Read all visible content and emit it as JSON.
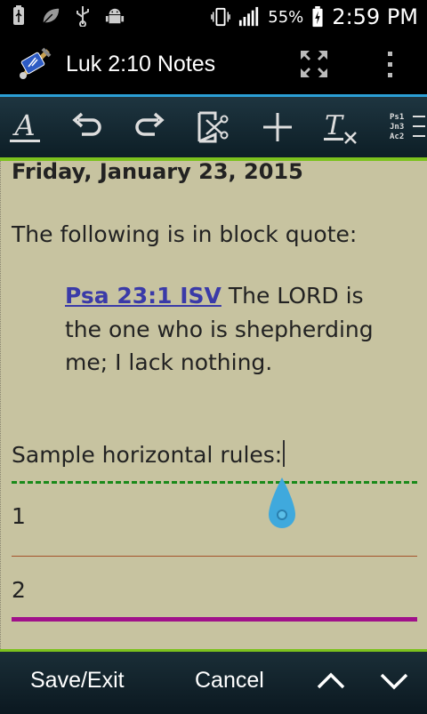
{
  "status_bar": {
    "battery_percent": "55%",
    "time": "2:59 PM"
  },
  "app_bar": {
    "title": "Luk 2:10 Notes"
  },
  "toolbar": {
    "buttons": [
      "format-text",
      "undo",
      "redo",
      "cut",
      "add",
      "clear-formatting",
      "verse-list"
    ],
    "verse_list_lines": [
      "Ps1",
      "Jn3",
      "Ac2"
    ]
  },
  "editor": {
    "date": "Friday, January 23, 2015",
    "paragraph1": "The following is in block quote:",
    "quote_ref": "Psa 23:1 ISV",
    "quote_text": " The LORD is the one who is shepherding me; I lack nothing.",
    "paragraph2": "Sample horizontal rules:",
    "rule_label_1": "1",
    "rule_label_2": "2",
    "colors": {
      "rule_dashed": "#1a8a1a",
      "rule_brown": "#a4522a",
      "rule_purple": "#a0108a",
      "link": "#3a3aa8",
      "background": "#c7c3a0"
    }
  },
  "bottom_bar": {
    "save_exit": "Save/Exit",
    "cancel": "Cancel"
  }
}
